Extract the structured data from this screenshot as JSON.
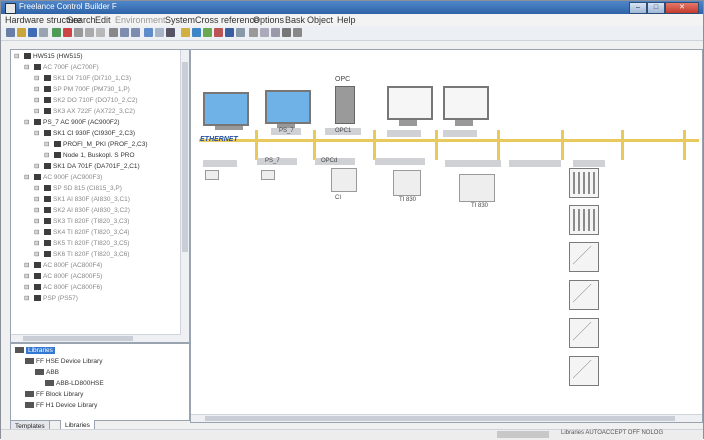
{
  "window": {
    "title": "Freelance Control Builder F",
    "buttons": [
      "–",
      "□",
      "✕"
    ]
  },
  "menubar": {
    "items": [
      "Hardware structure",
      "Search",
      "Edit",
      "Environment",
      "System",
      "Cross reference",
      "Options",
      "Bask",
      "Object",
      "Help"
    ]
  },
  "left_tree": {
    "rows": [
      {
        "text": "HW515 (HW515)",
        "indent": 0,
        "muted": false
      },
      {
        "text": "AC 700F (AC700F)",
        "indent": 1,
        "muted": true
      },
      {
        "text": "SK1 DI 710F (DI710_1,C3)",
        "indent": 2,
        "muted": true
      },
      {
        "text": "SP PM 700F (PM730_1,P)",
        "indent": 2,
        "muted": true
      },
      {
        "text": "SK2 DO 710F (DO710_2,C2)",
        "indent": 2,
        "muted": true
      },
      {
        "text": "SK3 AX 722F (AX722_3,C2)",
        "indent": 2,
        "muted": true
      },
      {
        "text": "PS_7   AC 900F (AC900F2)",
        "indent": 1,
        "muted": false
      },
      {
        "text": "SK1 CI 930F (CI930F_2,C3)",
        "indent": 2,
        "muted": false
      },
      {
        "text": "PROFI_M_PKI (PROF_2,C3)",
        "indent": 3,
        "muted": false
      },
      {
        "text": "Node 1, Buskopl. S PRO",
        "indent": 3,
        "muted": false
      },
      {
        "text": "SK1 DA 701F (DA701F_2,C1)",
        "indent": 2,
        "muted": false
      },
      {
        "text": "AC 900F (AC900F3)",
        "indent": 1,
        "muted": true
      },
      {
        "text": "SP SD 815 (CI815_3,P)",
        "indent": 2,
        "muted": true
      },
      {
        "text": "SK1 AI 830F (AI830_3,C1)",
        "indent": 2,
        "muted": true
      },
      {
        "text": "SK2 AI 830F (AI830_3,C2)",
        "indent": 2,
        "muted": true
      },
      {
        "text": "SK3 TI 820F (TI820_3,C3)",
        "indent": 2,
        "muted": true
      },
      {
        "text": "SK4 TI 820F (TI820_3,C4)",
        "indent": 2,
        "muted": true
      },
      {
        "text": "SK5 TI 820F (TI820_3,C5)",
        "indent": 2,
        "muted": true
      },
      {
        "text": "SK6 TI 820F (TI820_3,C6)",
        "indent": 2,
        "muted": true
      },
      {
        "text": "AC 800F (AC800F4)",
        "indent": 1,
        "muted": true
      },
      {
        "text": "AC 800F (AC800F5)",
        "indent": 1,
        "muted": true
      },
      {
        "text": "AC 800F (AC800F6)",
        "indent": 1,
        "muted": true
      },
      {
        "text": "PSP (PS57)",
        "indent": 1,
        "muted": true
      }
    ]
  },
  "library_tree": {
    "rows": [
      {
        "text": "Libraries",
        "indent": 0,
        "selected": true
      },
      {
        "text": "FF HSE Device Library",
        "indent": 1,
        "selected": false
      },
      {
        "text": "ABB",
        "indent": 2,
        "selected": false
      },
      {
        "text": "ABB-LD800HSE",
        "indent": 3,
        "selected": false
      },
      {
        "text": "FF Block Library",
        "indent": 1,
        "selected": false
      },
      {
        "text": "FF H1 Device Library",
        "indent": 1,
        "selected": false
      }
    ]
  },
  "tabs": [
    "Templates",
    "Libraries"
  ],
  "canvas": {
    "bus_label": "ETHERNET",
    "tower_label": "OPC",
    "station_labels": [
      "PS_7",
      "OPC1"
    ],
    "device_labels": [
      "PS_7",
      "OPCd",
      "CI",
      "TI 830",
      "TI 830"
    ]
  },
  "statusbar": {
    "text": "Libraries   AUTOACCEPT OFF   NOLOG"
  },
  "colors": {
    "title_bar": "#2f63a8",
    "bus": "#e8c95c",
    "ethernet_text": "#1f4ea0"
  }
}
